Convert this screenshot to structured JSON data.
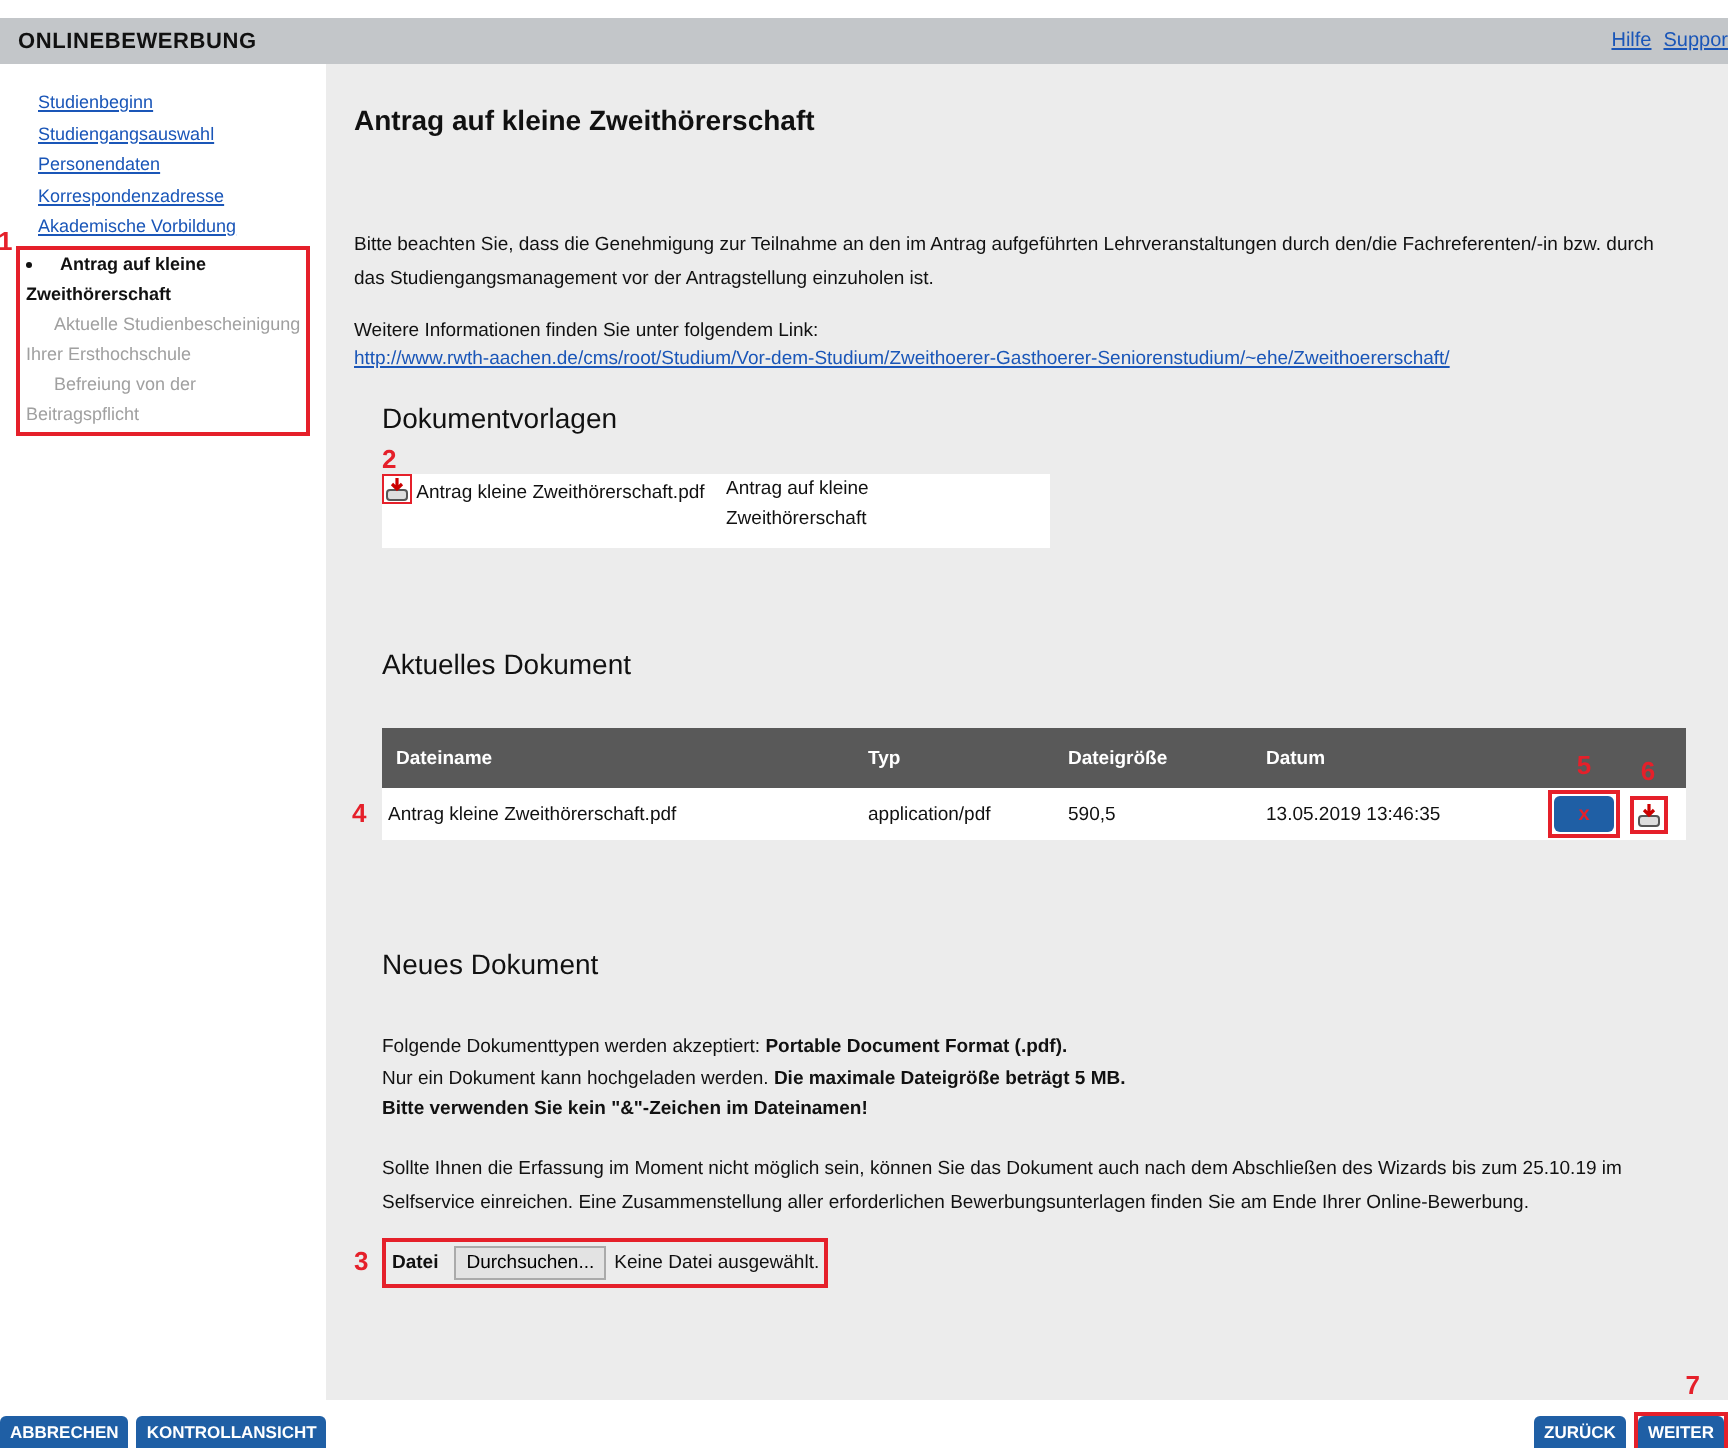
{
  "header": {
    "title": "ONLINEBEWERBUNG",
    "links": [
      "Hilfe",
      "Suppor"
    ]
  },
  "sidebar": {
    "callout": "1",
    "items": [
      {
        "label": "Studienbeginn",
        "kind": "link"
      },
      {
        "label": "Studiengangsauswahl",
        "kind": "link"
      },
      {
        "label": "Personendaten",
        "kind": "link"
      },
      {
        "label": "Korrespondenzadresse",
        "kind": "link"
      },
      {
        "label": "Akademische Vorbildung",
        "kind": "link"
      },
      {
        "label": "Antrag auf kleine Zweithörerschaft",
        "kind": "current"
      },
      {
        "label": "Aktuelle Studienbescheinigung Ihrer Ersthochschule",
        "kind": "substep"
      },
      {
        "label": "Befreiung von der Beitragspflicht",
        "kind": "substep"
      }
    ]
  },
  "page": {
    "title": "Antrag auf kleine Zweithörerschaft",
    "intro": "Bitte beachten Sie, dass die Genehmigung zur Teilnahme an den im Antrag aufgeführten Lehrveranstaltungen durch den/die Fachreferenten/-in bzw. durch das Studiengangsmanagement vor der Antragstellung einzuholen ist.",
    "info": "Weitere Informationen finden Sie unter folgendem Link:",
    "link": "http://www.rwth-aachen.de/cms/root/Studium/Vor-dem-Studium/Zweithoerer-Gasthoerer-Seniorenstudium/~ehe/Zweithoererschaft/"
  },
  "templates": {
    "heading": "Dokumentvorlagen",
    "callout": "2",
    "rows": [
      {
        "file": "Antrag kleine Zweithörerschaft.pdf",
        "description": "Antrag auf kleine Zweithörerschaft"
      }
    ]
  },
  "current_document": {
    "heading": "Aktuelles Dokument",
    "columns": [
      "Dateiname",
      "Typ",
      "Dateigröße",
      "Datum"
    ],
    "rows": [
      {
        "callout": "4",
        "delete_callout": "5",
        "download_callout": "6",
        "cells": [
          "Antrag kleine Zweithörerschaft.pdf",
          "application/pdf",
          "590,5",
          "13.05.2019 13:46:35"
        ],
        "delete_label": "x"
      }
    ]
  },
  "new_document": {
    "heading": "Neues Dokument",
    "notes": [
      "Folgende Dokumenttypen werden akzeptiert: **Portable Document Format (.pdf).**",
      "Nur ein Dokument kann hochgeladen werden. **Die maximale Dateigröße beträgt 5 MB.**",
      "**Bitte verwenden Sie kein \"&\"-Zeichen im Dateinamen!**"
    ],
    "hint": "Sollte Ihnen die Erfassung im Moment nicht möglich sein, können Sie das Dokument auch nach dem Abschließen des Wizards bis zum 25.10.19 im Selfservice einreichen. Eine Zusammenstellung aller erforderlichen Bewerbungsunterlagen finden Sie am Ende Ihrer Online-Bewerbung.",
    "upload": {
      "callout": "3",
      "label": "Datei",
      "button": "Durchsuchen...",
      "status": "Keine Datei ausgewählt."
    }
  },
  "footer": {
    "left": [
      "ABBRECHEN",
      "KONTROLLANSICHT"
    ],
    "right": [
      "ZURÜCK",
      "WEITER"
    ],
    "next_callout": "7"
  }
}
